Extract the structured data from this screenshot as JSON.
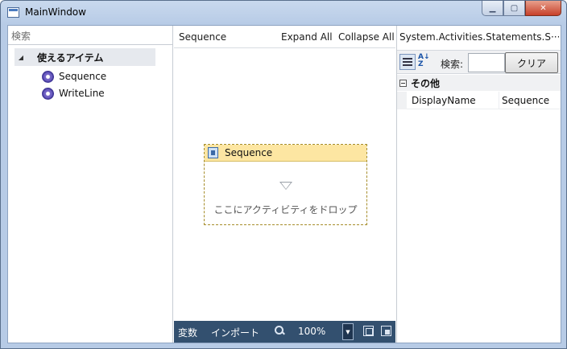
{
  "window": {
    "title": "MainWindow",
    "minimize_glyph": "▁",
    "maximize_glyph": "▢",
    "close_glyph": "✕"
  },
  "toolbox": {
    "search_placeholder": "検索",
    "category": {
      "label": "使えるアイテム",
      "expanded": true
    },
    "items": [
      {
        "label": "Sequence",
        "icon": "activity-gear-icon"
      },
      {
        "label": "WriteLine",
        "icon": "activity-gear-icon"
      }
    ]
  },
  "designer": {
    "breadcrumb": "Sequence",
    "expand_all": "Expand All",
    "collapse_all": "Collapse All",
    "activity": {
      "title": "Sequence",
      "drop_hint": "ここにアクティビティをドロップ"
    },
    "status_bar": {
      "variables": "変数",
      "imports": "インポート",
      "zoom": "100%"
    }
  },
  "properties": {
    "type_name": "System.Activities.Statements.S···",
    "search_label": "検索:",
    "search_value": "",
    "clear_button": "クリア",
    "category": "その他",
    "rows": [
      {
        "name": "DisplayName",
        "value": "Sequence"
      }
    ]
  },
  "colors": {
    "activity_header": "#fde6a2",
    "status_bar": "#33506f",
    "activity_border": "#a68d2b"
  }
}
